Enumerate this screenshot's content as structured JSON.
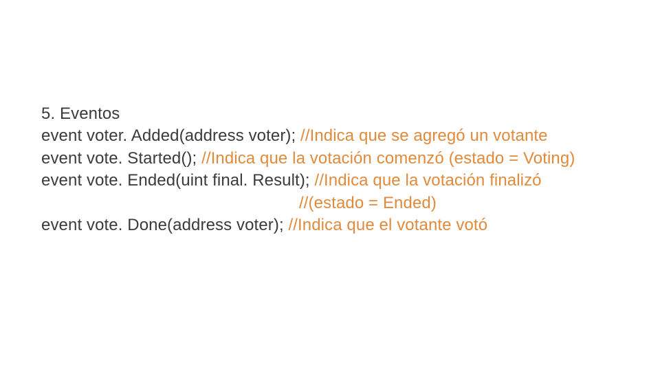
{
  "lines": {
    "l0": {
      "code": "5. Eventos"
    },
    "l1": {
      "code": "event voter. Added(address voter); ",
      "comment": "//Indica que se agregó un votante"
    },
    "l2": {
      "code": "event vote. Started(); ",
      "comment": "//Indica que la votación comenzó (estado = Voting)"
    },
    "l3": {
      "code": "event vote. Ended(uint final. Result); ",
      "comment": "//Indica que la votación finalizó"
    },
    "l4": {
      "comment": "//(estado = Ended)"
    },
    "l5": {
      "code": "event vote. Done(address voter); ",
      "comment": "//Indica que el votante votó"
    }
  }
}
